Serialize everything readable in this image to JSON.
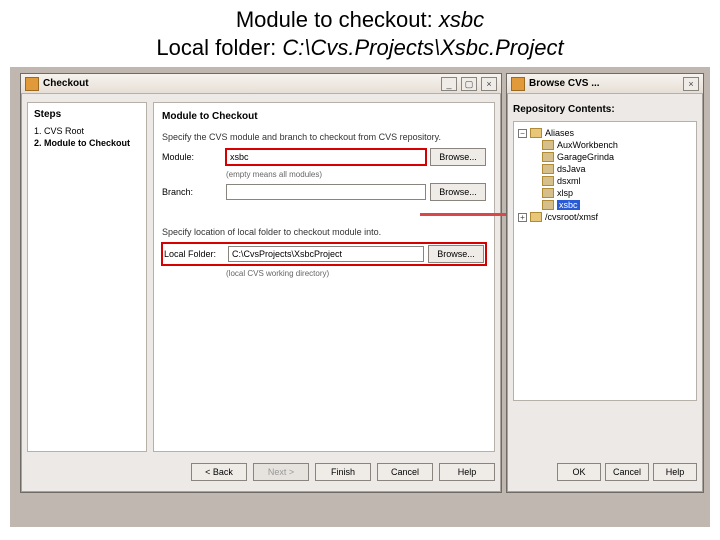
{
  "heading": {
    "line1_a": "Module to checkout: ",
    "line1_b": "xsbc",
    "line2_a": "Local folder:  ",
    "line2_b": "C:\\Cvs.Projects\\Xsbc.Project"
  },
  "checkout": {
    "title": "Checkout",
    "sidebar_heading": "Steps",
    "steps": [
      "CVS Root",
      "Module to Checkout"
    ],
    "main_heading": "Module to Checkout",
    "hint1": "Specify the CVS module and branch to checkout from CVS repository.",
    "module_label": "Module:",
    "module_value": "xsbc",
    "browse_label": "Browse...",
    "empty_hint": "(empty means all modules)",
    "branch_label": "Branch:",
    "branch_value": "",
    "hint2": "Specify location of local folder to checkout module into.",
    "localfolder_label": "Local Folder:",
    "localfolder_value": "C:\\CvsProjects\\XsbcProject",
    "wd_hint": "(local CVS working directory)",
    "buttons": {
      "back": "< Back",
      "next": "Next >",
      "finish": "Finish",
      "cancel": "Cancel",
      "help": "Help"
    }
  },
  "browse": {
    "title": "Browse CVS ...",
    "heading": "Repository Contents:",
    "root": "Aliases",
    "items": [
      {
        "label": "AuxWorkbench"
      },
      {
        "label": "GarageGrinda"
      },
      {
        "label": "dsJava"
      },
      {
        "label": "dsxml"
      },
      {
        "label": "xlsp"
      },
      {
        "label": "xsbc",
        "selected": true
      }
    ],
    "sibling": "/cvsroot/xmsf",
    "buttons": {
      "ok": "OK",
      "cancel": "Cancel",
      "help": "Help"
    }
  }
}
